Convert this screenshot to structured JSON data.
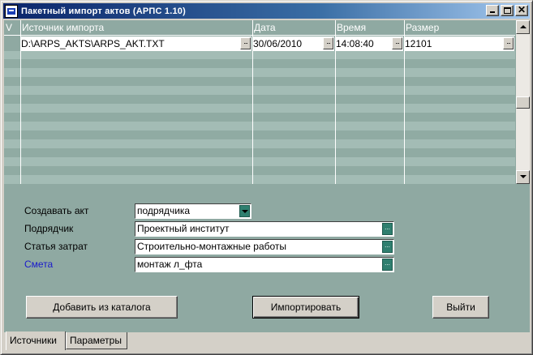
{
  "window": {
    "title": "Пакетный импорт актов  (АРПС 1.10)",
    "controls": {
      "minimize": "_",
      "maximize": "□",
      "close": "✕"
    }
  },
  "grid": {
    "columns": [
      "V",
      "Источник импорта",
      "Дата",
      "Время",
      "Размер"
    ],
    "rows": [
      {
        "source": "D:\\ARPS_AKTS\\ARPS_AKT.TXT",
        "date": "30/06/2010",
        "time": "14:08:40",
        "size": "12101"
      }
    ],
    "cell_button": "..."
  },
  "form": {
    "create_act": {
      "label": "Создавать акт",
      "value": "подрядчика"
    },
    "contractor": {
      "label": "Подрядчик",
      "value": "Проектный институт"
    },
    "cost_item": {
      "label": "Статья затрат",
      "value": "Строительно-монтажные работы"
    },
    "estimate": {
      "label": "Смета",
      "value": "монтаж л_фта"
    },
    "field_button": "..."
  },
  "buttons": {
    "add_from_catalog": "Добавить из каталога",
    "import": "Импортировать",
    "exit": "Выйти"
  },
  "tabs": [
    "Источники",
    "Параметры"
  ],
  "colors": {
    "client_bg": "#8fa9a2",
    "link": "#1a1acc",
    "field_button": "#2f7f6f"
  }
}
